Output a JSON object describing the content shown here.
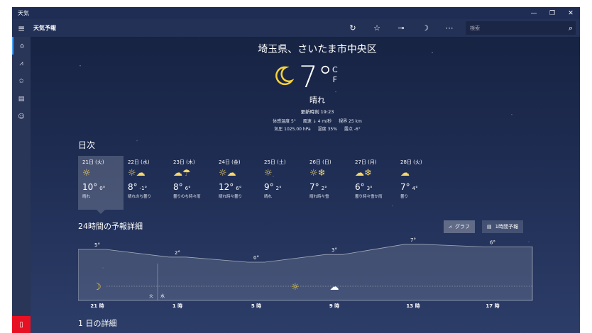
{
  "titlebar": {
    "title": "天気",
    "minimize": "—",
    "maximize": "❐",
    "close": "✕"
  },
  "appbar": {
    "title": "天気予報",
    "search_placeholder": "検索"
  },
  "icons": {
    "menu": "≡",
    "refresh": "↻",
    "favorite": "☆",
    "pin": "⊸",
    "moon": "☽",
    "more": "⋯",
    "search": "⌕",
    "home": "⌂",
    "chart": "⩘",
    "stars": "✩",
    "news": "▤",
    "smile": "☺",
    "feedback": "▯"
  },
  "current": {
    "location": "埼玉県、さいたま市中央区",
    "temp": "7°",
    "unit_c": "C",
    "unit_f": "F",
    "condition": "晴れ",
    "updated": "更新時刻 19:23",
    "feels_like": "体感温度  5°",
    "wind": "風速  ↓ 4 m/秒",
    "visibility": "視界  25 km",
    "pressure": "気圧  1025.00 hPa",
    "humidity": "湿度  35%",
    "dewpoint": "露点  -6°"
  },
  "daily": {
    "heading": "日次",
    "days": [
      {
        "date": "21日 (火)",
        "icon": "☼",
        "high": "10°",
        "low": "0°",
        "cond": "晴れ"
      },
      {
        "date": "22日 (水)",
        "icon": "☼☁",
        "high": "8°",
        "low": "-1°",
        "cond": "晴れのち曇り"
      },
      {
        "date": "23日 (木)",
        "icon": "☁☂",
        "high": "8°",
        "low": "6°",
        "cond": "曇りのち時々雨"
      },
      {
        "date": "24日 (金)",
        "icon": "☼☁",
        "high": "12°",
        "low": "6°",
        "cond": "晴れ時々曇り"
      },
      {
        "date": "25日 (土)",
        "icon": "☼",
        "high": "9°",
        "low": "2°",
        "cond": "晴れ"
      },
      {
        "date": "26日 (日)",
        "icon": "☼❄",
        "high": "7°",
        "low": "2°",
        "cond": "晴れ時々雪"
      },
      {
        "date": "27日 (月)",
        "icon": "☁❄",
        "high": "6°",
        "low": "3°",
        "cond": "曇り時々雪か雨"
      },
      {
        "date": "28日 (火)",
        "icon": "☁",
        "high": "7°",
        "low": "4°",
        "cond": "曇り"
      }
    ]
  },
  "hourly": {
    "heading": "24時間の予報詳細",
    "graph_button": "グラフ",
    "hourly_button": "1時間予報",
    "day_left": "火",
    "day_right": "水",
    "times": [
      "21 時",
      "1 時",
      "5 時",
      "9 時",
      "13 時",
      "17 時"
    ],
    "temps": [
      5,
      2,
      0,
      3,
      7,
      6
    ],
    "temp_labels": [
      "5°",
      "2°",
      "0°",
      "3°",
      "7°",
      "6°"
    ],
    "cond_icons": [
      "☽",
      "☼",
      "☁"
    ]
  },
  "details_heading": "1 日の詳細"
}
